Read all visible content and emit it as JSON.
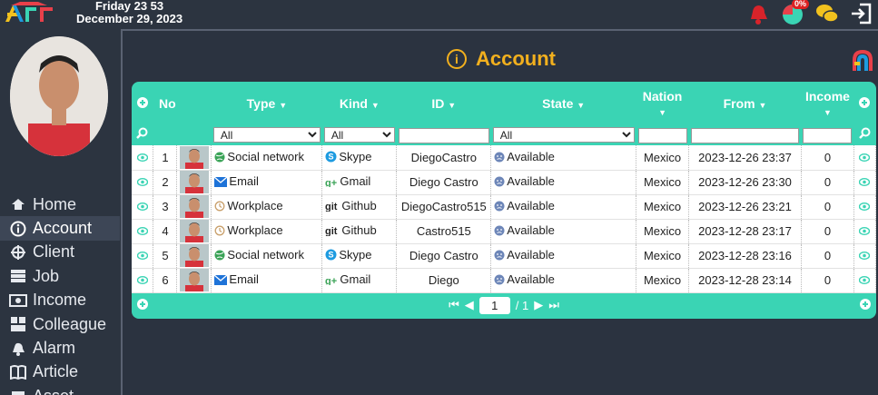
{
  "header": {
    "day_time": "Friday 23 53",
    "date": "December 29, 2023",
    "progress_badge": "0%"
  },
  "sidebar": {
    "items": [
      {
        "label": "Home",
        "icon": "home-icon"
      },
      {
        "label": "Account",
        "icon": "info-icon"
      },
      {
        "label": "Client",
        "icon": "client-icon"
      },
      {
        "label": "Job",
        "icon": "job-icon"
      },
      {
        "label": "Income",
        "icon": "money-icon"
      },
      {
        "label": "Colleague",
        "icon": "colleague-icon"
      },
      {
        "label": "Alarm",
        "icon": "alarm-icon"
      },
      {
        "label": "Article",
        "icon": "book-icon"
      },
      {
        "label": "Asset",
        "icon": "asset-icon"
      }
    ]
  },
  "page": {
    "title": "Account"
  },
  "table": {
    "headers": {
      "no": "No",
      "type": "Type",
      "kind": "Kind",
      "id": "ID",
      "state": "State",
      "nation": "Nation",
      "from": "From",
      "income": "Income"
    },
    "filters": {
      "type": "All",
      "kind": "All",
      "state": "All"
    },
    "rows": [
      {
        "no": "1",
        "type": "Social network",
        "type_icon": "globe",
        "kind": "Skype",
        "kind_icon": "skype",
        "id": "DiegoCastro",
        "state": "Available",
        "nation": "Mexico",
        "from": "2023-12-26 23:37",
        "income": "0"
      },
      {
        "no": "2",
        "type": "Email",
        "type_icon": "mail",
        "kind": "Gmail",
        "kind_icon": "gplus",
        "id": "Diego Castro",
        "state": "Available",
        "nation": "Mexico",
        "from": "2023-12-26 23:30",
        "income": "0"
      },
      {
        "no": "3",
        "type": "Workplace",
        "type_icon": "history",
        "kind": "Github",
        "kind_icon": "git",
        "id": "DiegoCastro515",
        "state": "Available",
        "nation": "Mexico",
        "from": "2023-12-26 23:21",
        "income": "0"
      },
      {
        "no": "4",
        "type": "Workplace",
        "type_icon": "history",
        "kind": "Github",
        "kind_icon": "git",
        "id": "Castro515",
        "state": "Available",
        "nation": "Mexico",
        "from": "2023-12-28 23:17",
        "income": "0"
      },
      {
        "no": "5",
        "type": "Social network",
        "type_icon": "globe",
        "kind": "Skype",
        "kind_icon": "skype",
        "id": "Diego Castro",
        "state": "Available",
        "nation": "Mexico",
        "from": "2023-12-28 23:16",
        "income": "0"
      },
      {
        "no": "6",
        "type": "Email",
        "type_icon": "mail",
        "kind": "Gmail",
        "kind_icon": "gplus",
        "id": "Diego",
        "state": "Available",
        "nation": "Mexico",
        "from": "2023-12-28 23:14",
        "income": "0"
      }
    ],
    "pager": {
      "page": "1",
      "total": "/ 1"
    }
  },
  "colors": {
    "accent": "#3ad4b4",
    "title": "#f2b01e",
    "background": "#2b3340"
  }
}
